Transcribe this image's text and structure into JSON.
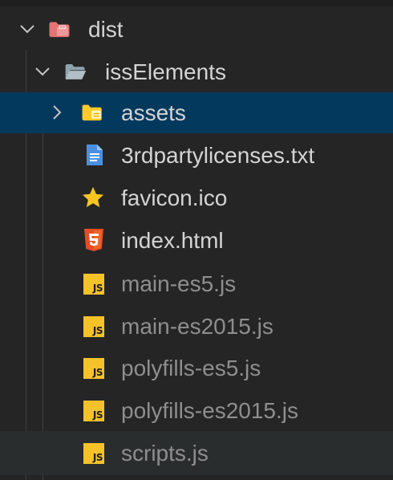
{
  "explorer": {
    "root": {
      "label": "dist",
      "expanded": true,
      "icon": "folder-open-red-icon"
    },
    "child_folder": {
      "label": "issElements",
      "expanded": true,
      "icon": "folder-open-icon"
    },
    "items": [
      {
        "label": "assets",
        "type": "folder",
        "icon": "folder-assets-icon",
        "selected": true
      },
      {
        "label": "3rdpartylicenses.txt",
        "type": "file",
        "icon": "text-file-icon"
      },
      {
        "label": "favicon.ico",
        "type": "file",
        "icon": "star-icon"
      },
      {
        "label": "index.html",
        "type": "file",
        "icon": "html5-icon"
      },
      {
        "label": "main-es5.js",
        "type": "file",
        "icon": "js-icon",
        "dimmed": true
      },
      {
        "label": "main-es2015.js",
        "type": "file",
        "icon": "js-icon",
        "dimmed": true
      },
      {
        "label": "polyfills-es5.js",
        "type": "file",
        "icon": "js-icon",
        "dimmed": true
      },
      {
        "label": "polyfills-es2015.js",
        "type": "file",
        "icon": "js-icon",
        "dimmed": true
      },
      {
        "label": "scripts.js",
        "type": "file",
        "icon": "js-icon",
        "dimmed": true
      }
    ],
    "js_icon_text": "JS",
    "colors": {
      "background": "#252526",
      "selected_row": "#04395e",
      "text": "#d4d4d4",
      "dimmed_text": "#8e8e8e",
      "js_badge": "#f5c22a",
      "html5_badge": "#e44d26",
      "star": "#f7c520",
      "text_file": "#4a90e2",
      "folder": "#90a4ae",
      "root_folder": "#e57373",
      "assets_folder": "#ffca28"
    }
  }
}
